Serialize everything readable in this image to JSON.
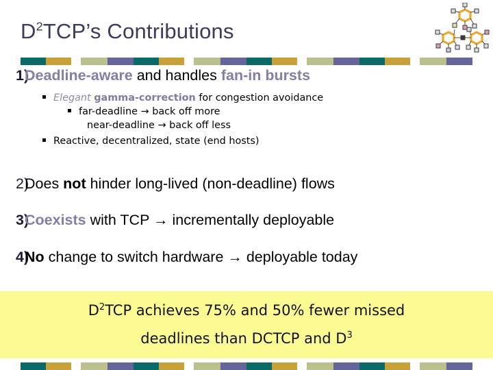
{
  "slide": {
    "title_prefix": "D",
    "title_sup": "2",
    "title_rest": "TCP’s Contributions",
    "background_color": "#ffffff"
  },
  "logo": {
    "name": "network-graph-logo",
    "ring_color": "#e8a72e",
    "node_fill": "#d9d9e0"
  },
  "stripe": {
    "colors": {
      "teal": "#0a6b66",
      "gold": "#c8a238",
      "sage": "#bcc08d",
      "purple": "#64659b"
    },
    "unit_count": 4
  },
  "items": [
    {
      "number": "1)",
      "segments": [
        {
          "text": "Deadline-aware",
          "style": "accent"
        },
        {
          "text": " and handles ",
          "style": "plain"
        },
        {
          "text": "fan-in bursts",
          "style": "accent"
        }
      ]
    },
    {
      "number": "2)",
      "segments": [
        {
          "text": "Does ",
          "style": "plain"
        },
        {
          "text": "not",
          "style": "strong"
        },
        {
          "text": " hinder long-lived (non-deadline) flows",
          "style": "plain"
        }
      ]
    },
    {
      "number": "3)",
      "segments": [
        {
          "text": "Coexists",
          "style": "accent"
        },
        {
          "text": " with TCP → incrementally deployable",
          "style": "plain"
        }
      ]
    },
    {
      "number": "4)",
      "segments": [
        {
          "text": "No",
          "style": "strong"
        },
        {
          "text": " change to switch hardware → deployable today",
          "style": "plain"
        }
      ]
    }
  ],
  "sub_bullets": [
    {
      "level": 2,
      "has_bullet": true,
      "segments": [
        {
          "text": "Elegant ",
          "style": "ital-accent"
        },
        {
          "text": "gamma-correction",
          "style": "bold-accent"
        },
        {
          "text": " for congestion avoidance",
          "style": "plain"
        }
      ]
    },
    {
      "level": 3,
      "has_bullet": true,
      "segments": [
        {
          "text": "far-deadline → back off more",
          "style": "plain"
        }
      ]
    },
    {
      "level": 3,
      "has_bullet": false,
      "segments": [
        {
          "text": "near-deadline → back off less",
          "style": "plain"
        }
      ]
    },
    {
      "level": 2,
      "has_bullet": true,
      "segments": [
        {
          "text": "Reactive, decentralized, state (end hosts)",
          "style": "plain"
        }
      ]
    }
  ],
  "highlight": {
    "background_color": "#fcfa92",
    "line1_prefix": "D",
    "line1_sup": "2",
    "line1_rest": "TCP achieves 75% and 50% fewer missed",
    "line2_prefix": "deadlines than DCTCP and D",
    "line2_sup": "3"
  }
}
